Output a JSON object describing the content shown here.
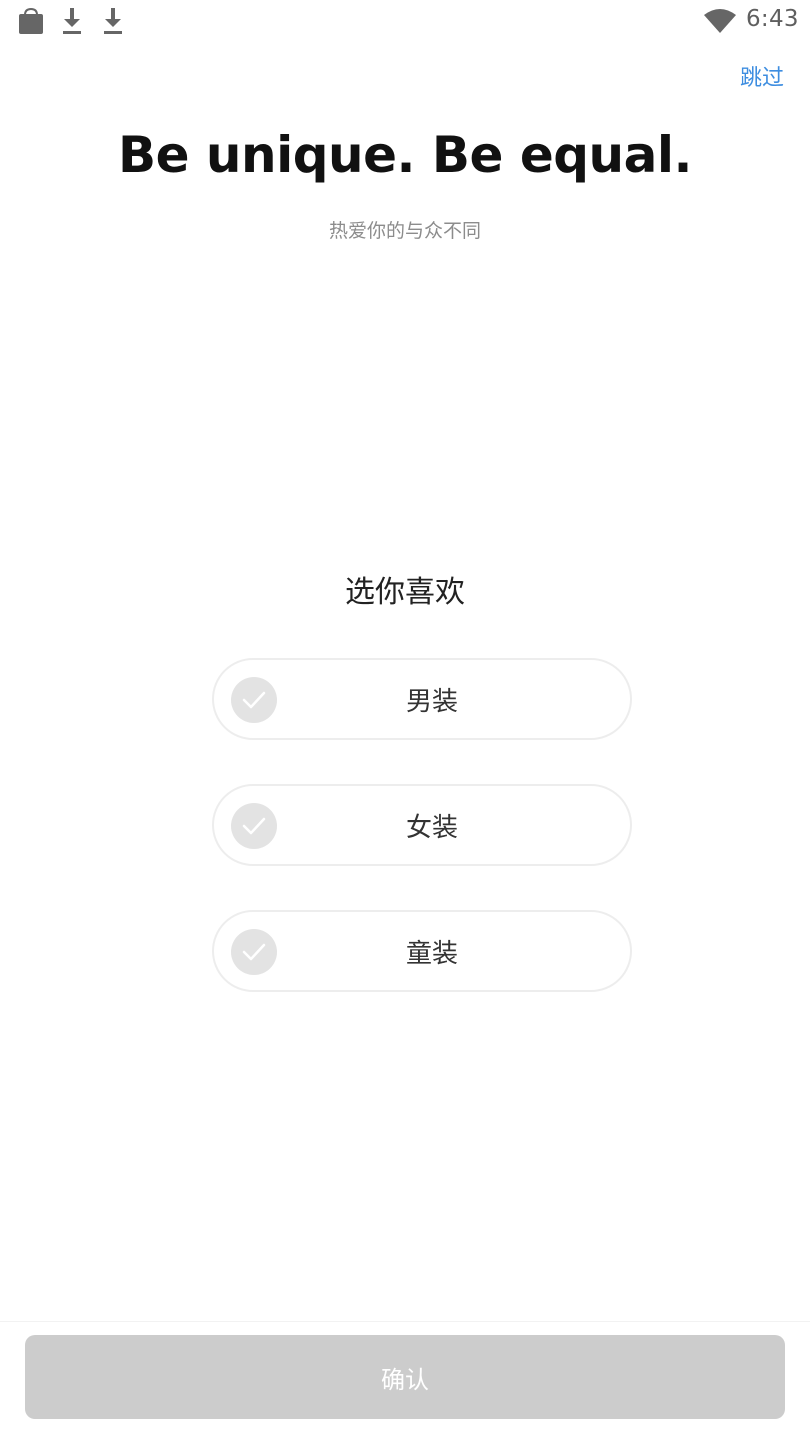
{
  "status_bar": {
    "time": "6:43",
    "icons": [
      "shopping-bag-icon",
      "download-icon",
      "download-icon",
      "wifi-icon"
    ]
  },
  "header": {
    "skip_label": "跳过"
  },
  "hero": {
    "title": "Be unique. Be equal.",
    "subtitle": "热爱你的与众不同"
  },
  "selection": {
    "question": "选你喜欢",
    "options": [
      {
        "label": "男装",
        "selected": false
      },
      {
        "label": "女装",
        "selected": false
      },
      {
        "label": "童装",
        "selected": false
      }
    ]
  },
  "footer": {
    "confirm_label": "确认",
    "confirm_enabled": false
  },
  "colors": {
    "accent": "#3d8de0",
    "button_disabled": "#cccccc",
    "check_inactive": "#e3e3e3"
  }
}
